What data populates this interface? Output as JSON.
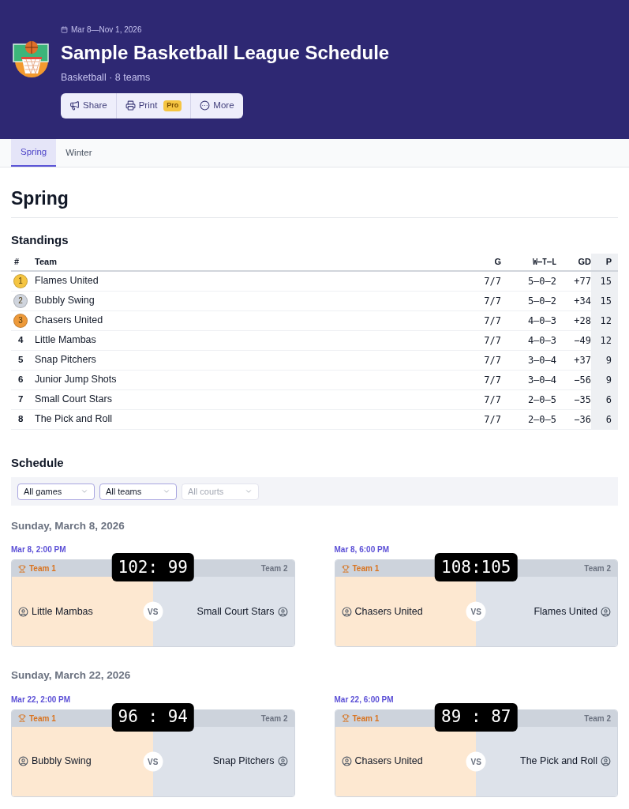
{
  "header": {
    "dates": "Mar 8—Nov 1, 2026",
    "title": "Sample Basketball League Schedule",
    "subtitle": "Basketball · 8 teams",
    "actions": [
      {
        "kind": "share",
        "label": "Share"
      },
      {
        "kind": "print",
        "label": "Print",
        "badge": "Pro"
      },
      {
        "kind": "more",
        "label": "More"
      }
    ]
  },
  "tabs": [
    {
      "label": "Spring",
      "selected": true
    },
    {
      "label": "Winter",
      "selected": false
    }
  ],
  "season_title": "Spring",
  "standings": {
    "title": "Standings",
    "columns": [
      "#",
      "Team",
      "G",
      "W–T–L",
      "GD",
      "P"
    ],
    "rows": [
      {
        "rank": "1",
        "color": "#f5c542",
        "team": "Flames United",
        "g": "7/7",
        "wtl": "5–0–2",
        "gd": "+77",
        "p": "15"
      },
      {
        "rank": "2",
        "color": "#d0d5de",
        "team": "Bubbly Swing",
        "g": "7/7",
        "wtl": "5–0–2",
        "gd": "+34",
        "p": "15"
      },
      {
        "rank": "3",
        "color": "#ee9a3a",
        "team": "Chasers United",
        "g": "7/7",
        "wtl": "4–0–3",
        "gd": "+28",
        "p": "12"
      },
      {
        "rank": "4",
        "team": "Little Mambas",
        "g": "7/7",
        "wtl": "4–0–3",
        "gd": "−49",
        "p": "12"
      },
      {
        "rank": "5",
        "team": "Snap Pitchers",
        "g": "7/7",
        "wtl": "3–0–4",
        "gd": "+37",
        "p": "9"
      },
      {
        "rank": "6",
        "team": "Junior Jump Shots",
        "g": "7/7",
        "wtl": "3–0–4",
        "gd": "−56",
        "p": "9"
      },
      {
        "rank": "7",
        "team": "Small Court Stars",
        "g": "7/7",
        "wtl": "2–0–5",
        "gd": "−35",
        "p": "6"
      },
      {
        "rank": "8",
        "team": "The Pick and Roll",
        "g": "7/7",
        "wtl": "2–0–5",
        "gd": "−36",
        "p": "6"
      }
    ]
  },
  "schedule": {
    "title": "Schedule",
    "filters": [
      {
        "value": "All games",
        "disabled": false
      },
      {
        "value": "All teams",
        "disabled": false
      },
      {
        "value": "All courts",
        "disabled": true
      }
    ],
    "days": [
      {
        "date": "Sunday, March 8, 2026",
        "games": [
          {
            "time": "Mar 8, 2:00 PM",
            "score": "102: 99",
            "team1_label": "Team 1",
            "team2_label": "Team 2",
            "team1": "Little Mambas",
            "team2": "Small Court Stars",
            "vs": "VS",
            "team1_won": true,
            "team2_won": false
          },
          {
            "time": "Mar 8, 6:00 PM",
            "score": "108:105",
            "team1_label": "Team 1",
            "team2_label": "Team 2",
            "team1": "Chasers United",
            "team2": "Flames United",
            "vs": "VS",
            "team1_won": true,
            "team2_won": false
          }
        ]
      },
      {
        "date": "Sunday, March 22, 2026",
        "games": [
          {
            "time": "Mar 22, 2:00 PM",
            "score": "96 : 94",
            "team1_label": "Team 1",
            "team2_label": "Team 2",
            "team1": "Bubbly Swing",
            "team2": "Snap Pitchers",
            "vs": "VS",
            "team1_won": true,
            "team2_won": false
          },
          {
            "time": "Mar 22, 6:00 PM",
            "score": "89 : 87",
            "team1_label": "Team 1",
            "team2_label": "Team 2",
            "team1": "Chasers United",
            "team2": "The Pick and Roll",
            "vs": "VS",
            "team1_won": true,
            "team2_won": false
          }
        ]
      }
    ]
  }
}
